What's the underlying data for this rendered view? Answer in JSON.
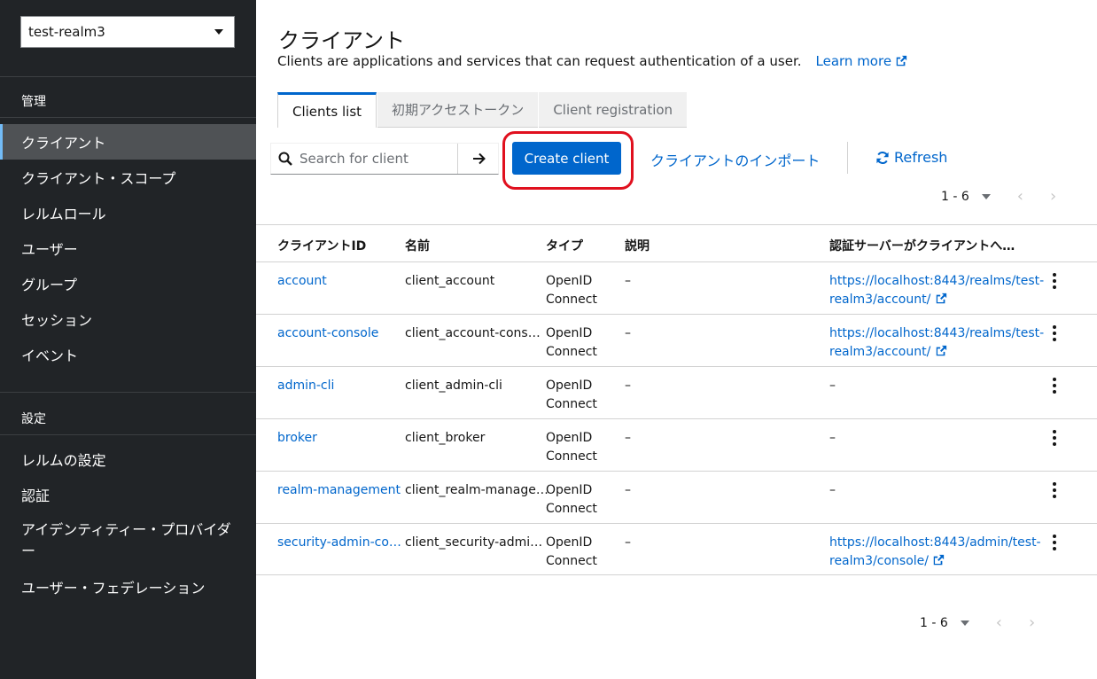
{
  "sidebar": {
    "realm": "test-realm3",
    "section_manage": "管理",
    "manage_items": [
      {
        "label": "クライアント",
        "active": true
      },
      {
        "label": "クライアント・スコープ"
      },
      {
        "label": "レルムロール"
      },
      {
        "label": "ユーザー"
      },
      {
        "label": "グループ"
      },
      {
        "label": "セッション"
      },
      {
        "label": "イベント"
      }
    ],
    "section_configure": "設定",
    "configure_items": [
      {
        "label": "レルムの設定"
      },
      {
        "label": "認証"
      },
      {
        "label": "アイデンティティー・プロバイダー"
      },
      {
        "label": "ユーザー・フェデレーション"
      }
    ]
  },
  "header": {
    "title": "クライアント",
    "description": "Clients are applications and services that can request authentication of a user.",
    "learn_more": "Learn more"
  },
  "tabs": [
    {
      "label": "Clients list",
      "active": true
    },
    {
      "label": "初期アクセストークン"
    },
    {
      "label": "Client registration"
    }
  ],
  "toolbar": {
    "search_placeholder": "Search for client",
    "create_label": "Create client",
    "import_label": "クライアントのインポート",
    "refresh_label": "Refresh"
  },
  "pagination": {
    "range": "1 - 6"
  },
  "table": {
    "headers": [
      "クライアントID",
      "名前",
      "タイプ",
      "説明",
      "認証サーバーがクライアントへ…"
    ],
    "rows": [
      {
        "id": "account",
        "name": "client_account",
        "type1": "OpenID",
        "type2": "Connect",
        "desc": "–",
        "url1": "https://localhost:8443/realms/test-",
        "url2": "realm3/account/"
      },
      {
        "id": "account-console",
        "name": "client_account-cons…",
        "type1": "OpenID",
        "type2": "Connect",
        "desc": "–",
        "url1": "https://localhost:8443/realms/test-",
        "url2": "realm3/account/"
      },
      {
        "id": "admin-cli",
        "name": "client_admin-cli",
        "type1": "OpenID",
        "type2": "Connect",
        "desc": "–",
        "url1": "–",
        "url2": ""
      },
      {
        "id": "broker",
        "name": "client_broker",
        "type1": "OpenID",
        "type2": "Connect",
        "desc": "–",
        "url1": "–",
        "url2": ""
      },
      {
        "id": "realm-management",
        "name": "client_realm-manage…",
        "type1": "OpenID",
        "type2": "Connect",
        "desc": "–",
        "url1": "–",
        "url2": ""
      },
      {
        "id": "security-admin-co…",
        "name": "client_security-admi…",
        "type1": "OpenID",
        "type2": "Connect",
        "desc": "–",
        "url1": "https://localhost:8443/admin/test-",
        "url2": "realm3/console/"
      }
    ]
  },
  "colors": {
    "accent": "#0066cc",
    "sidebar_bg": "#212427",
    "highlight": "#e0101e"
  },
  "icons": {
    "search": "search-icon",
    "arrow": "arrow-right-icon",
    "refresh": "sync-icon",
    "external": "external-link-icon",
    "kebab": "kebab-icon"
  }
}
